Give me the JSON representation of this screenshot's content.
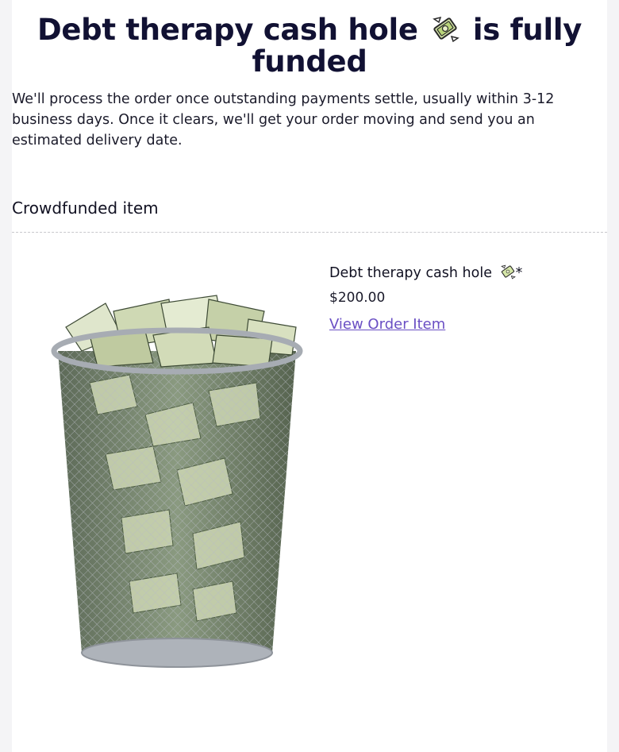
{
  "header": {
    "title_before_icon": "Debt therapy cash hole",
    "title_after_icon": "is fully funded",
    "title_icon": "money-wings-emoji"
  },
  "intro": {
    "text": "We'll process the order once outstanding payments settle, usually within 3-12 business days. Once it clears, we'll get your order moving and send you an estimated delivery date."
  },
  "section": {
    "heading": "Crowdfunded item"
  },
  "item": {
    "name": "Debt therapy cash hole",
    "name_icon": "money-wings-emoji",
    "asterisk": "*",
    "price": "$200.00",
    "link_label": "View Order Item",
    "image_icon": "trash-can-full-of-money-image"
  },
  "colors": {
    "title": "#111133",
    "link": "#6a4fc4",
    "divider": "#c8c8cc"
  }
}
